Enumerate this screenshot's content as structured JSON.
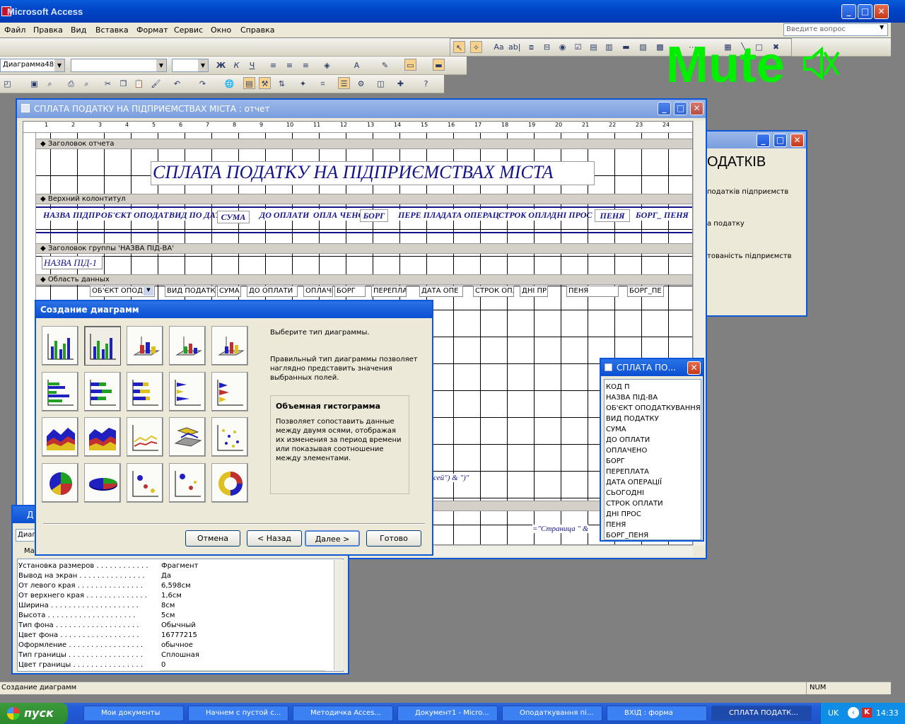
{
  "app": {
    "title": "Microsoft Access"
  },
  "menu": [
    "Файл",
    "Правка",
    "Вид",
    "Вставка",
    "Формат",
    "Сервис",
    "Окно",
    "Справка"
  ],
  "question_placeholder": "Введите вопрос",
  "toolbar": {
    "object_combo": "Диаграмма48"
  },
  "overlay": {
    "mute": "Mute"
  },
  "report_window": {
    "title": "СПЛАТА ПОДАТКУ НА ПІДПРИЄМСТВАХ МІСТА : отчет",
    "ruler": [
      "1",
      "2",
      "3",
      "4",
      "5",
      "6",
      "7",
      "8",
      "9",
      "10",
      "11",
      "12",
      "13",
      "14",
      "15",
      "16",
      "17",
      "18",
      "19",
      "20",
      "21",
      "22",
      "23",
      "24"
    ],
    "bands": {
      "report_header": "Заголовок отчета",
      "page_header": "Верхний колонтитул",
      "group_header": "Заголовок группы 'НАЗВА ПІД-ВА'",
      "detail": "Область данных"
    },
    "report_title": "СПЛАТА ПОДАТКУ НА ПІДПРИЄМСТВАХ МІСТА",
    "column_headers": [
      "НАЗВА ПІДПР-ВА",
      "ОБ'ЄКТ ОПОДАТКУВ",
      "ВИД ПО ДАТКУ",
      "СУМА",
      "ДО ОПЛАТИ",
      "ОПЛА ЧЕНО",
      "БОРГ",
      "ПЕРЕ ПЛАТА",
      "ДАТА ОПЕРАЦІЇ",
      "СТРОК ОПЛАТ",
      "ДНІ ПРОС",
      "ПЕНЯ",
      "БОРГ_ ПЕНЯ"
    ],
    "group_field": "НАЗВА ПІД-1",
    "detail_fields": [
      "ОБ'ЄКТ ОПОД",
      "ВИД ПОДАТК",
      "СУМА",
      "ДО ОПЛАТИ",
      "ОПЛАЧЕ",
      "БОРГ",
      "ПЕРЕПЛА",
      "ДАТА ОПЕ",
      "СТРОК ОПЛ",
      "ДНІ ПР",
      "ПЕНЯ",
      "БОРГ_ПЕ"
    ],
    "footer_expr1": "сей\") & \")\"",
    "footer_expr2": "=\"Страница \" &"
  },
  "background_window": {
    "heading": "ОДАТКІВ",
    "lines": [
      "податків підприємств",
      "а податку",
      "тованість підприємств"
    ]
  },
  "chart_wizard": {
    "title": "Создание диаграмм",
    "prompt": "Выберите тип диаграммы.",
    "hint": "Правильный тип диаграммы позволяет наглядно представить значения выбранных полей.",
    "selected_name": "Объемная гистограмма",
    "selected_desc": "Позволяет сопоставить данные между двумя осями, отображая их изменения за период времени или показывая соотношение между элементами.",
    "buttons": {
      "cancel": "Отмена",
      "back": "< Назад",
      "next": "Далее >",
      "finish": "Готово"
    }
  },
  "field_list": {
    "title": "СПЛАТА ПО...",
    "fields": [
      "КОД П",
      "НАЗВА ПІД-ВА",
      "ОБ'ЄКТ ОПОДАТКУВАННЯ",
      "ВИД ПОДАТКУ",
      "СУМА",
      "ДО ОПЛАТИ",
      "ОПЛАЧЕНО",
      "БОРГ",
      "ПЕРЕПЛАТА",
      "ДАТА ОПЕРАЦІЇ",
      "СЬОГОДНІ",
      "СТРОК ОПЛАТИ",
      "ДНІ ПРОС",
      "ПЕНЯ",
      "БОРГ_ПЕНЯ"
    ]
  },
  "properties": {
    "title_fragment": "Д",
    "combo_fragment": "Диаг",
    "tab_fragment": "Ма",
    "rows": [
      {
        "k": "Установка размеров . . . . . . . . . . . .",
        "v": "Фрагмент"
      },
      {
        "k": "Вывод на экран . . . . . . . . . . . . . . .",
        "v": "Да"
      },
      {
        "k": "От левого края . . . . . . . . . . . . . . .",
        "v": "6,598см"
      },
      {
        "k": "От верхнего края . . . . . . . . . . . . . .",
        "v": "1,6см"
      },
      {
        "k": "Ширина . . . . . . . . . . . . . . . . . . . .",
        "v": "8см"
      },
      {
        "k": "Высота . . . . . . . . . . . . . . . . . . . .",
        "v": "5см"
      },
      {
        "k": "Тип фона . . . . . . . . . . . . . . . . . . .",
        "v": "Обычный"
      },
      {
        "k": "Цвет фона . . . . . . . . . . . . . . . . . .",
        "v": "16777215"
      },
      {
        "k": "Оформление . . . . . . . . . . . . . . . . .",
        "v": "обычное"
      },
      {
        "k": "Тип границы . . . . . . . . . . . . . . . . .",
        "v": "Сплошная"
      },
      {
        "k": "Цвет границы . . . . . . . . . . . . . . . .",
        "v": "0"
      }
    ]
  },
  "status": {
    "left": "Создание диаграмм",
    "num": "NUM"
  },
  "taskbar": {
    "start": "пуск",
    "tasks": [
      "Мои документы",
      "Начнем с пустой с...",
      "Методичка Acces...",
      "Документ1 - Micro...",
      "Оподаткування пі...",
      "ВХІД : форма",
      "СПЛАТА ПОДАТК..."
    ],
    "lang": "UK",
    "clock": "14:33"
  }
}
